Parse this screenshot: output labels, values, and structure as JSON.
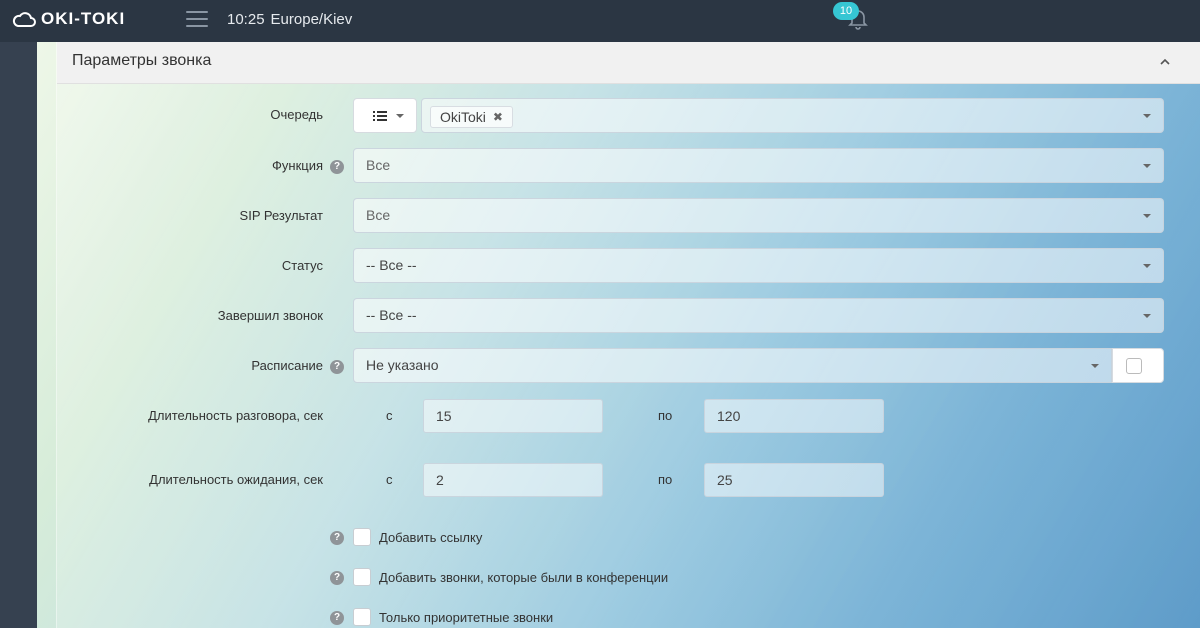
{
  "navbar": {
    "brand": "OKI-TOKI",
    "time": "10:25",
    "timezone": "Europe/Kiev",
    "notifications_count": "10"
  },
  "panel": {
    "title": "Параметры звонка"
  },
  "form": {
    "queue": {
      "label": "Очередь",
      "tag": "OkiToki"
    },
    "function": {
      "label": "Функция",
      "value": "Все"
    },
    "sip_result": {
      "label": "SIP Результат",
      "value": "Все"
    },
    "status": {
      "label": "Статус",
      "value": "-- Все --"
    },
    "ended_call": {
      "label": "Завершил звонок",
      "value": "-- Все --"
    },
    "schedule": {
      "label": "Расписание",
      "value": "Не указано"
    },
    "talk_duration": {
      "label": "Длительность разговора, сек",
      "from_label": "с",
      "to_label": "по",
      "from": "15",
      "to": "120"
    },
    "wait_duration": {
      "label": "Длительность ожидания, сек",
      "from_label": "с",
      "to_label": "по",
      "from": "2",
      "to": "25"
    },
    "checkboxes": [
      {
        "label": "Добавить ссылку"
      },
      {
        "label": "Добавить звонки, которые были в конференции"
      },
      {
        "label": "Только приоритетные звонки"
      }
    ]
  }
}
